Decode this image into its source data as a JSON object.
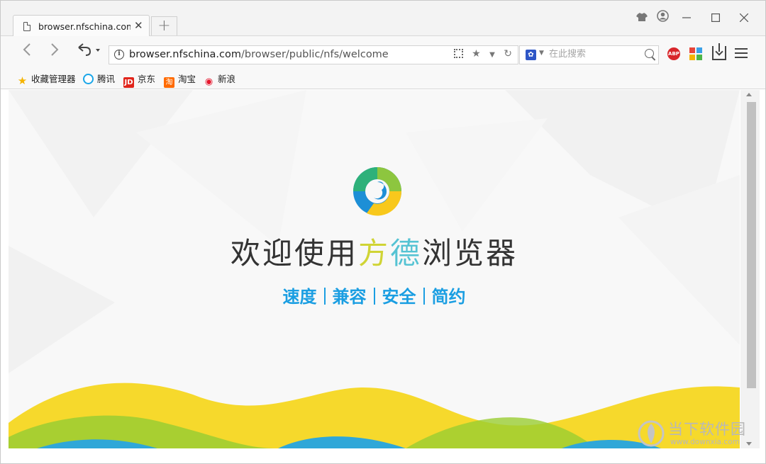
{
  "window": {
    "title_icons": [
      "skin-icon",
      "account-icon",
      "minimize-icon",
      "maximize-icon",
      "close-icon"
    ]
  },
  "tab": {
    "title": "browser.nfschina.com/",
    "close_glyph": "✕",
    "new_tab_glyph": "+"
  },
  "toolbar": {
    "back_glyph": "‹",
    "forward_glyph": "›",
    "undo_glyph": "↶",
    "undo_caret": "▾",
    "url_host": "browser.nfschina.com",
    "url_path": "/browser/public/nfs/welcome",
    "search_placeholder": "在此搜索",
    "abp_label": "ABP"
  },
  "bookmarks": [
    {
      "label": "收藏管理器",
      "icon": "star-icon",
      "color": "#f5b400"
    },
    {
      "label": "腾讯",
      "icon": "tencent-icon",
      "color": "#1aa6e8"
    },
    {
      "label": "京东",
      "icon": "jd-icon",
      "color": "#e1251b"
    },
    {
      "label": "淘宝",
      "icon": "taobao-icon",
      "color": "#ff6a00"
    },
    {
      "label": "新浪",
      "icon": "weibo-icon",
      "color": "#e6162d"
    }
  ],
  "page": {
    "headline_a": "欢迎使用",
    "headline_b1": "方",
    "headline_b2": "德",
    "headline_c": "浏览器",
    "tagline": [
      "速度",
      "兼容",
      "安全",
      "简约"
    ],
    "accent_blue": "#1a9ee2",
    "accent_green": "#d0d435",
    "accent_cyan": "#55c3d3"
  },
  "watermark": {
    "name": "当下软件园",
    "url": "www.downxia.com"
  }
}
